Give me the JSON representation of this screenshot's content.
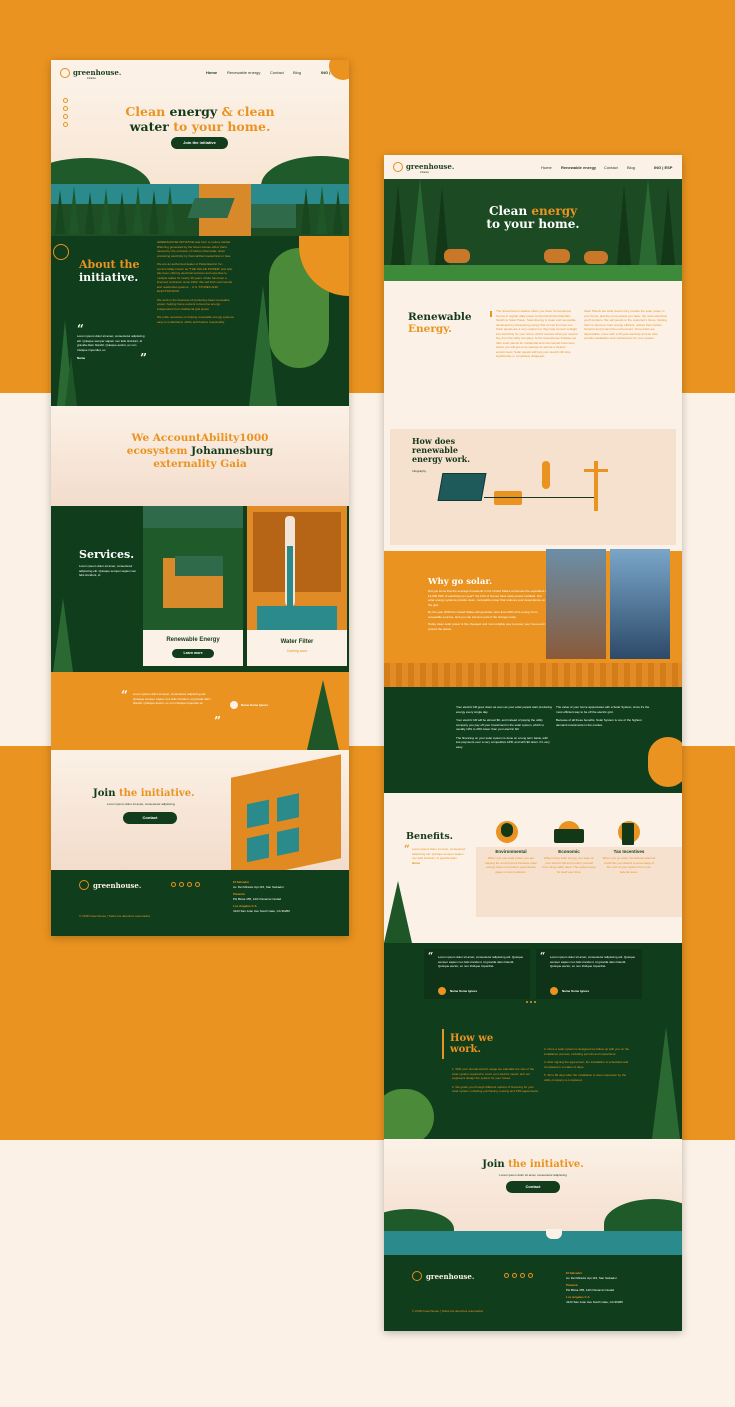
{
  "colors": {
    "orange": "#ea9320",
    "dark_green": "#103d1c",
    "cream": "#fbf1e6"
  },
  "left": {
    "nav": {
      "logo_text": "greenhouse.",
      "logo_sub": "initiative",
      "links": [
        "Home",
        "Renewable energy",
        "Contact",
        "Blog"
      ],
      "lang": "ING | ESP"
    },
    "hero": {
      "title_line1_orange": "Clean",
      "title_line1_dark": "energy",
      "title_line1_amp": "& clean",
      "title_line2_dark": "water",
      "title_line2_orange": "to your home.",
      "cta": "Join the initiative"
    },
    "about": {
      "title": "About the",
      "title2": "initiative.",
      "quote": "Lorem ipsum dolor sit amet, consectetur adipiscing elit. Quisque semper sapien nec felis tincidunt, id gravida diam blandit. Quisque auctor, ex non tristique imperdiet, ex",
      "quote_name": "Name",
      "body1": "GREENHOUSE INITIATIVE was born to reduce Global Warming generated by the Green House effect that's caused by the emission of Carbon Monoxide; when producing electricity by thermal/thermoelectrical or Gas.",
      "body2": "We are an authorized dealer of Pellet Electric Inc., commercially known as \"THE SOLAR POWER\" and who has been offering electrical services and expertise to multiple states for nearly 30 years. Pellet has been a licensed contractor since 1992. We sell both commercial and residential systems. - U.S. STORES AND ELECTRICIANS.",
      "body3": "We work in the business of producing clean renewable power, helping home owners to become energy independent from traditional grid power.",
      "body4": "We pride ourselves on helping renewable energy systems easy to understand, utilize and finance responsibly."
    },
    "accountability": {
      "line1": "We AccountAbility1000",
      "line2_orange": "ecosystem",
      "line2_dark": "Johannesburg",
      "line3": "externality Gaia"
    },
    "services": {
      "title": "Services.",
      "text": "Lorem ipsum dolor sit amet, consectetur adipiscing elit. Quisque semper sapien nec felis tincidunt, id",
      "card1_title": "Renewable Energy",
      "card1_btn": "Learn more",
      "card2_title": "Water Filter",
      "card2_sub": "Coming soon"
    },
    "testimonial": {
      "text": "Lorem ipsum dolor sit amet, consectetur adipiscing elit. Quisque semper sapien nec felis tincidunt, id gravida diam blandit. Quisque auctor, ex non tristique imperdiet ex",
      "name": "Name Some Ignore"
    },
    "join": {
      "title_dark": "Join",
      "title_orange": "the initiative.",
      "sub": "Lorem ipsum dolor sit amet, consectetur adipiscing.",
      "btn": "Contact"
    },
    "footer": {
      "logo_text": "greenhouse.",
      "copy": "© 2018 Greenhouse | Todos los derechos reservados",
      "loc1_title": "El Salvador",
      "loc1_addr": "Av. Del Mirador Apt 115, San Salvador",
      "loc2_title": "Panamá",
      "loc2_addr": "PH Bicsa 455, 12th Panamá Ciudad",
      "loc3_title": "Los Angeles C.A",
      "loc3_addr": "4123 San Juan Ave South Gate, CA 90280"
    }
  },
  "right": {
    "nav": {
      "logo_text": "greenhouse.",
      "logo_sub": "initiative",
      "links": [
        "Home",
        "Renewable energy",
        "Contact",
        "Blog"
      ],
      "lang": "ING | ESP"
    },
    "hero": {
      "line1_white": "Clean",
      "line1_orange": "energy",
      "line2": "to your home."
    },
    "renewable": {
      "title1": "Renewable",
      "title2": "Energy.",
      "col1": "The Greenhouse Initiative offers you lower Conventional homes in regular daily power to the Dominican Republic. Switch to Solar Power. Solar Energy is clean and renewable, developed by harnessing energy that comes from the sun. Solar panels are a very useful tool; they help convert sunlight into electricity for your home, which reduces what you need to buy from the utility company. At the Greenhouse Initiative we offer solar panels for residential and commercial customers, where you will get more savings as well as a cleaner environment. Solar panels will help your electric bill drop significantly or completely disappear.",
      "col2": "Solar Panels are solid pieces they provide the solar power in your home, and the more panels you have, the more electricity you'll produce. We sell panels to the customer's home, helping them to become more energy efficient, reduce their carbon footprint and protect the environment. Our panels are dependable, come with a 25-year warranty and we also provide installation and maintenance for your system."
    },
    "infographic": {
      "title1": "How does",
      "title2": "renewable",
      "title3": "energy work.",
      "label": "Infography"
    },
    "why": {
      "title": "Why go solar.",
      "p1": "Did you know that the average household in the United States consumes the equivalent of 12,000 kWh of electricity per year? Yet 11% of homes have solar panels installed. Our solar energy systems provide clean, renewable power that reduces your dependence on the grid.",
      "p2": "By the year 2030 the United States will generate more than 20% of its energy from renewable sources, and you can become part of the change today.",
      "p3": "Today clean solar power is the cheapest and most reliable way to power your home and protect the planet."
    },
    "bullets_left": [
      "Your electric bill goes down as soon as your solar panels start producing energy every single day.",
      "Your electric bill will be almost $0, and instead of paying the utility company you pay off your investment in the solar system, which is usually 10% to 20% lower than your electric bill.",
      "The financing on your solar system is done on a long term basis, with low payments over a very competitive APR, and with $0 down. It's very easy."
    ],
    "bullets_right": [
      "The value of your home appreciates with a Solar System, since it's the most efficient way to be off the electric grid.",
      "Because of all these benefits, Solar System is one of the highest demand investments in the market."
    ],
    "benefits": {
      "title": "Benefits.",
      "quote": "Lorem ipsum dolor sit amet, consectetur adipiscing elit. Quisque semper sapien nec felis tincidunt, id gravida diam.",
      "quote_name": "Name",
      "items": [
        {
          "title": "Environmental",
          "text": "When you use solar power you are helping the environment because solar energy does not produce greenhouse gases or toxic pollution."
        },
        {
          "title": "Economic",
          "text": "When using solar energy you save on your electric bill and protect yourself from rising utility rates. The system pays for itself over time."
        },
        {
          "title": "Tax Incentives",
          "text": "When you go solar, the federal solar tax credit lets you deduct a percentage of the cost of your system from your federal taxes."
        }
      ]
    },
    "testimonials": [
      {
        "text": "Lorem ipsum dolor sit amet, consectetur adipiscing elit. Quisque semper sapien nec felis tincidunt, id gravida diam blandit. Quisque auctor, ex non tristique imperdiet.",
        "name": "Name Some Ignore"
      },
      {
        "text": "Lorem ipsum dolor sit amet, consectetur adipiscing elit. Quisque semper sapien nec felis tincidunt, id gravida diam blandit. Quisque auctor, ex non tristique imperdiet.",
        "name": "Name Some Ignore"
      }
    ],
    "how": {
      "title1": "How we",
      "title2": "work.",
      "left": [
        "1. With your annual electric usage we calculate the size of the solar system required to cover your electric needs, and our engineers design the system for your house.",
        "2. We guide you through different options of financing for your solar system, including purchasing, leasing and PPA agreements."
      ],
      "right": [
        "3. Once a solar system is designed we follow up with you on the installation process, including permits and inspections.",
        "4. After signing the agreement, the installation is scheduled and completed in a matter of days.",
        "5. 30 to 90 days after the installation is done inspection by the utility company is completed."
      ]
    },
    "join": {
      "title_dark": "Join",
      "title_orange": "the initiative.",
      "sub": "Lorem ipsum dolor sit amet, consectetur adipiscing",
      "btn": "Contact"
    },
    "footer": {
      "logo_text": "greenhouse.",
      "copy": "© 2018 Greenhouse | Todos los derechos reservados",
      "loc1_title": "El Salvador",
      "loc1_addr": "Av. Del Mirador Apt 115, San Salvador",
      "loc2_title": "Panamá",
      "loc2_addr": "PH Bicsa 455, 12th Panamá Ciudad",
      "loc3_title": "Los Angeles C.A",
      "loc3_addr": "4123 San Juan Ave South Gate, CA 90280"
    }
  }
}
